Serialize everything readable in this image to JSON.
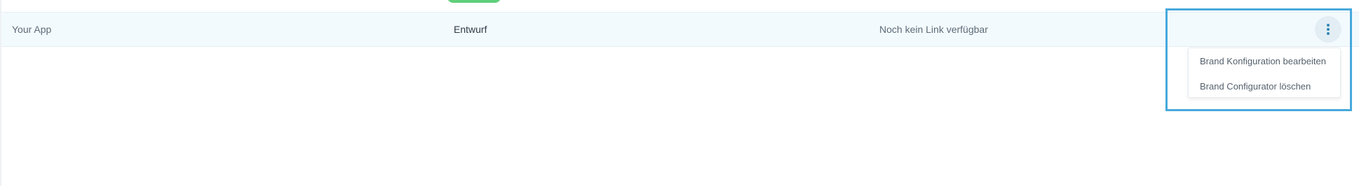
{
  "table": {
    "row": {
      "name": "Your App",
      "status": "Entwurf",
      "link": "Noch kein Link verfügbar"
    },
    "status_pill_color": "#5fcf7a",
    "row_background": "#f3fafd"
  },
  "menu": {
    "button_icon": "more-vertical-icon",
    "items": [
      {
        "label": "Brand Konfiguration bearbeiten"
      },
      {
        "label": "Brand Configurator löschen"
      }
    ]
  },
  "highlight_color": "#47a9dc"
}
